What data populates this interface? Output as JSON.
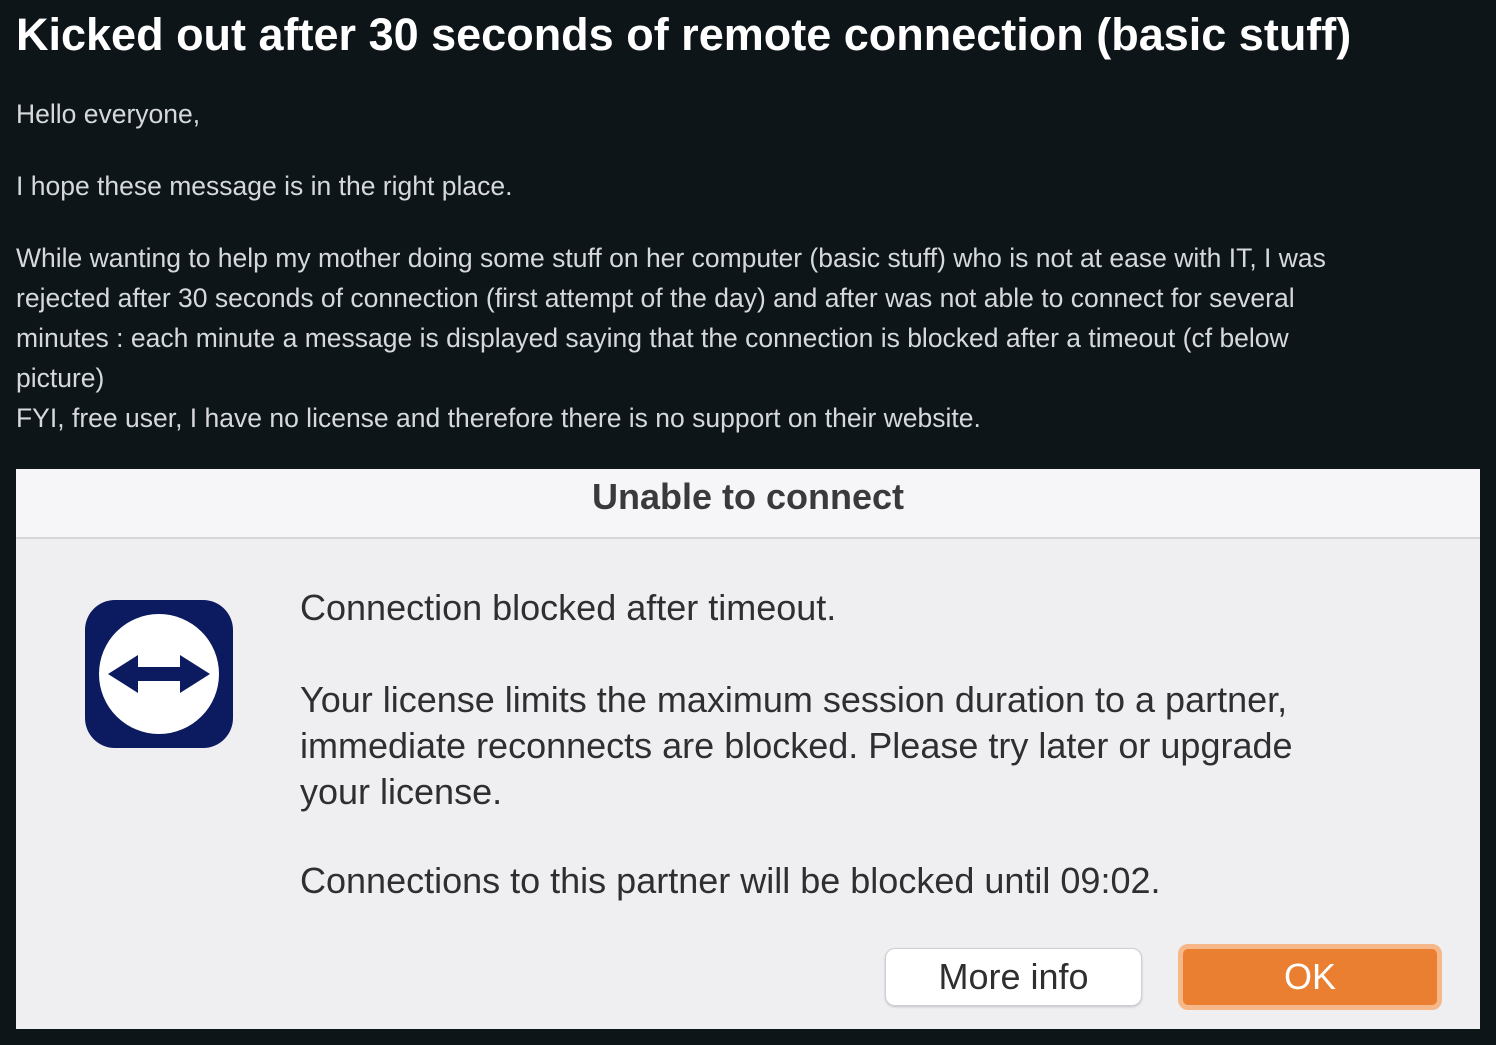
{
  "post": {
    "title": "Kicked out after 30 seconds of remote connection (basic stuff)",
    "greeting": "Hello everyone,",
    "line_hope": "I hope these message is in the right place.",
    "body_lines": [
      "While wanting to help my mother doing some stuff on her computer (basic stuff) who is not at ease with IT, I was",
      "rejected after 30 seconds of connection (first attempt of the day) and after was not able to connect for several",
      "minutes : each minute a message is displayed saying that the connection is blocked after a timeout (cf below",
      "picture)"
    ],
    "fyi": "FYI, free user, I have no license and therefore there is no support on their website."
  },
  "dialog": {
    "title": "Unable to connect",
    "icon": "teamviewer-arrows-icon",
    "heading": "Connection blocked after timeout.",
    "detail_lines": [
      "Your license limits the maximum session duration to a partner,",
      "immediate reconnects are blocked. Please try later or upgrade",
      "your license."
    ],
    "blocked_until": "Connections to this partner will be blocked until 09:02.",
    "buttons": {
      "more_info": "More info",
      "ok": "OK"
    }
  },
  "colors": {
    "page_background": "#0e1519",
    "icon_background": "#0c1a60",
    "ok_button": "#ea7f32"
  }
}
